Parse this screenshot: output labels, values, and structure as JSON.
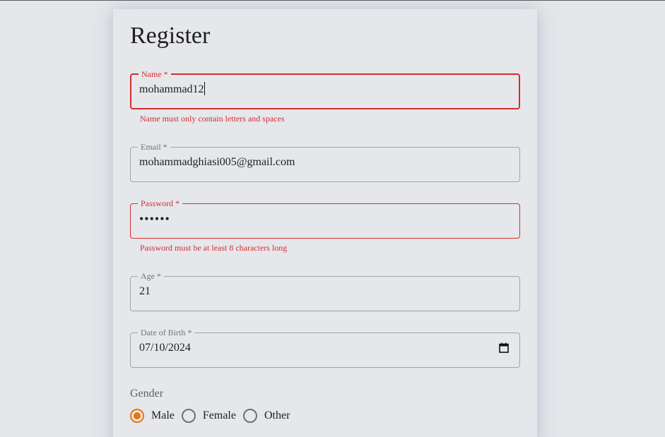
{
  "form": {
    "title": "Register",
    "fields": {
      "name": {
        "label": "Name *",
        "value": "mohammad12",
        "error": "Name must only contain letters and spaces"
      },
      "email": {
        "label": "Email *",
        "value": "mohammadghiasi005@gmail.com"
      },
      "password": {
        "label": "Password *",
        "value": "••••••",
        "error": "Password must be at least 8 characters long"
      },
      "age": {
        "label": "Age *",
        "value": "21"
      },
      "dob": {
        "label": "Date of Birth *",
        "value": "07/10/2024",
        "icon": "calendar-icon"
      }
    },
    "gender": {
      "label": "Gender",
      "options": [
        "Male",
        "Female",
        "Other"
      ],
      "selected": "Male"
    }
  },
  "colors": {
    "error": "#d32f2f",
    "accent": "#e8740c",
    "border": "#a2a4a8",
    "background": "#e4e6ea"
  }
}
